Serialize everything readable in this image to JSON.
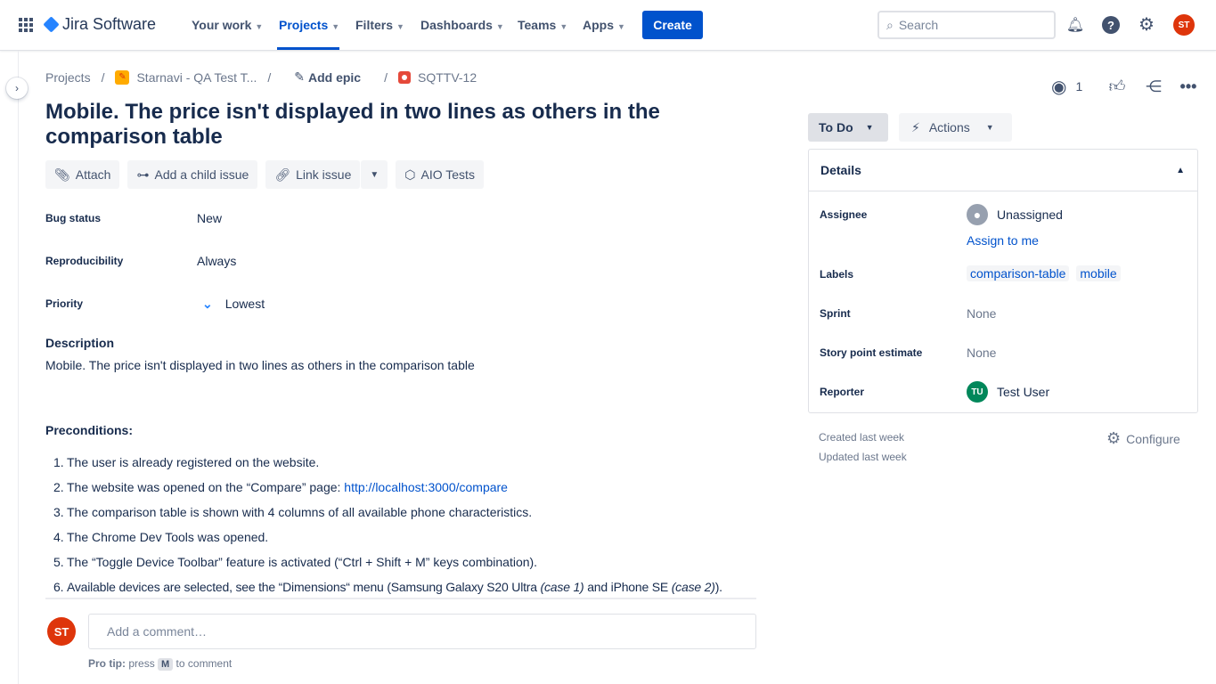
{
  "nav": {
    "product": "Jira Software",
    "items": [
      {
        "label": "Your work"
      },
      {
        "label": "Projects"
      },
      {
        "label": "Filters"
      },
      {
        "label": "Dashboards"
      },
      {
        "label": "Teams"
      },
      {
        "label": "Apps"
      }
    ],
    "create": "Create",
    "search_placeholder": "Search",
    "user_initials": "ST"
  },
  "breadcrumb": {
    "projects": "Projects",
    "project": "Starnavi - QA Test T...",
    "epic": "Add epic",
    "issue_key": "SQTTV-12"
  },
  "issue": {
    "title": "Mobile. The price isn't displayed in two lines as others in the comparison table",
    "buttons": {
      "attach": "Attach",
      "child": "Add a child issue",
      "link": "Link issue",
      "aio": "AIO Tests"
    },
    "fields": [
      {
        "label": "Bug status",
        "value": "New"
      },
      {
        "label": "Reproducibility",
        "value": "Always"
      },
      {
        "label": "Priority",
        "value": "Lowest"
      }
    ],
    "description_heading": "Description",
    "description": "Mobile. The price isn't displayed in two lines as others in the comparison table",
    "preconditions_heading": "Preconditions:",
    "preconditions": [
      {
        "num": "1.",
        "text": "The user is already registered on the website."
      },
      {
        "num": "2.",
        "text": "The website was opened on the “Compare” page: ",
        "link": "http://localhost:3000/compare"
      },
      {
        "num": "3.",
        "text": "The comparison table is shown with 4 columns of all available phone characteristics."
      },
      {
        "num": "4.",
        "text": "The Chrome Dev Tools was opened."
      },
      {
        "num": "5.",
        "text": "The “Toggle Device Toolbar” feature is activated (“Ctrl + Shift + M” keys combination)."
      },
      {
        "num": "6.",
        "text": "Available devices are selected, see the “Dimensions“ menu (Samsung Galaxy S20 Ultra ",
        "em1": "(case 1)",
        "mid": " and iPhone SE ",
        "em2": "(case 2)",
        "end": ")."
      }
    ]
  },
  "comment": {
    "placeholder": "Add a comment…",
    "protip_bold": "Pro tip:",
    "protip_press": "press",
    "key": "M",
    "protip_end": "to comment"
  },
  "side": {
    "watchers": "1",
    "status": "To Do",
    "actions": "Actions",
    "details_title": "Details",
    "assignee_label": "Assignee",
    "assignee": "Unassigned",
    "assign_to_me": "Assign to me",
    "labels_label": "Labels",
    "labels": [
      "comparison-table",
      "mobile"
    ],
    "sprint_label": "Sprint",
    "sprint": "None",
    "story_label": "Story point estimate",
    "story": "None",
    "reporter_label": "Reporter",
    "reporter": "Test User",
    "reporter_initials": "TU",
    "created": "Created last week",
    "updated": "Updated last week",
    "configure": "Configure"
  },
  "colors": {
    "brand": "#0052cc",
    "user_avatar": "#de350b",
    "reporter_avatar": "#00875a"
  }
}
